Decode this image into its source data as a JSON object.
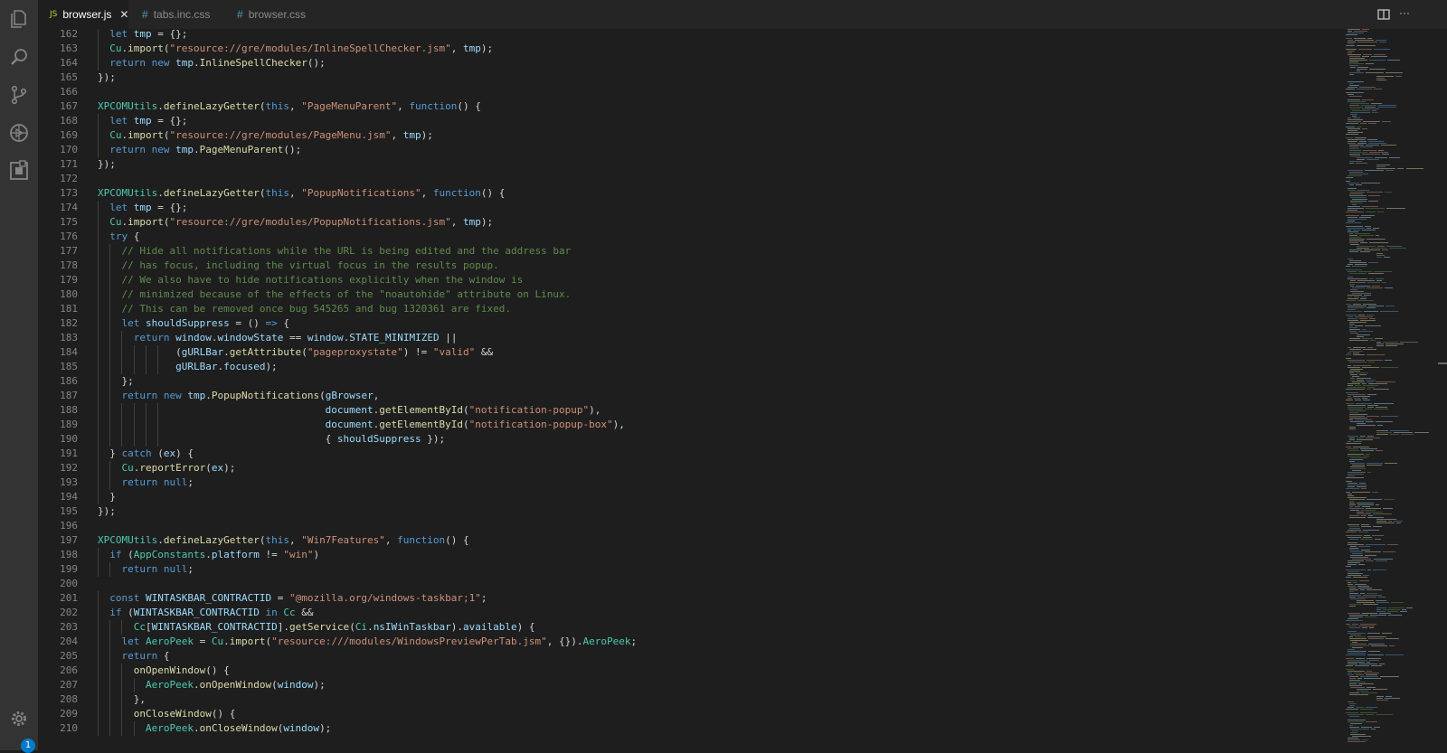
{
  "tabs": [
    {
      "label": "browser.js",
      "icon": "JS",
      "active": true
    },
    {
      "label": "tabs.inc.css",
      "icon": "#",
      "active": false
    },
    {
      "label": "browser.css",
      "icon": "#",
      "active": false
    }
  ],
  "close_glyph": "✕",
  "more_glyph": "···",
  "settings_badge": "1",
  "activity_bar": [
    "explorer-icon",
    "search-icon",
    "source-control-icon",
    "debug-icon",
    "extensions-icon",
    "settings-gear-icon"
  ],
  "colors": {
    "keyword": "#569cd6",
    "string": "#ce9178",
    "comment": "#608b4e",
    "function": "#dcdcaa",
    "variable": "#9cdcfe",
    "accent": "#007acc"
  },
  "code_lines": [
    {
      "n": "162",
      "text": "  let tmp = {};"
    },
    {
      "n": "163",
      "text": "  Cu.import(\"resource://gre/modules/InlineSpellChecker.jsm\", tmp);"
    },
    {
      "n": "164",
      "text": "  return new tmp.InlineSpellChecker();"
    },
    {
      "n": "165",
      "text": "});"
    },
    {
      "n": "166",
      "text": ""
    },
    {
      "n": "167",
      "text": "XPCOMUtils.defineLazyGetter(this, \"PageMenuParent\", function() {"
    },
    {
      "n": "168",
      "text": "  let tmp = {};"
    },
    {
      "n": "169",
      "text": "  Cu.import(\"resource://gre/modules/PageMenu.jsm\", tmp);"
    },
    {
      "n": "170",
      "text": "  return new tmp.PageMenuParent();"
    },
    {
      "n": "171",
      "text": "});"
    },
    {
      "n": "172",
      "text": ""
    },
    {
      "n": "173",
      "text": "XPCOMUtils.defineLazyGetter(this, \"PopupNotifications\", function() {"
    },
    {
      "n": "174",
      "text": "  let tmp = {};"
    },
    {
      "n": "175",
      "text": "  Cu.import(\"resource://gre/modules/PopupNotifications.jsm\", tmp);"
    },
    {
      "n": "176",
      "text": "  try {"
    },
    {
      "n": "177",
      "text": "    // Hide all notifications while the URL is being edited and the address bar"
    },
    {
      "n": "178",
      "text": "    // has focus, including the virtual focus in the results popup."
    },
    {
      "n": "179",
      "text": "    // We also have to hide notifications explicitly when the window is"
    },
    {
      "n": "180",
      "text": "    // minimized because of the effects of the \"noautohide\" attribute on Linux."
    },
    {
      "n": "181",
      "text": "    // This can be removed once bug 545265 and bug 1320361 are fixed."
    },
    {
      "n": "182",
      "text": "    let shouldSuppress = () => {"
    },
    {
      "n": "183",
      "text": "      return window.windowState == window.STATE_MINIMIZED ||"
    },
    {
      "n": "184",
      "text": "             (gURLBar.getAttribute(\"pageproxystate\") != \"valid\" &&"
    },
    {
      "n": "185",
      "text": "             gURLBar.focused);"
    },
    {
      "n": "186",
      "text": "    };"
    },
    {
      "n": "187",
      "text": "    return new tmp.PopupNotifications(gBrowser,"
    },
    {
      "n": "188",
      "text": "                                      document.getElementById(\"notification-popup\"),"
    },
    {
      "n": "189",
      "text": "                                      document.getElementById(\"notification-popup-box\"),"
    },
    {
      "n": "190",
      "text": "                                      { shouldSuppress });"
    },
    {
      "n": "191",
      "text": "  } catch (ex) {"
    },
    {
      "n": "192",
      "text": "    Cu.reportError(ex);"
    },
    {
      "n": "193",
      "text": "    return null;"
    },
    {
      "n": "194",
      "text": "  }"
    },
    {
      "n": "195",
      "text": "});"
    },
    {
      "n": "196",
      "text": ""
    },
    {
      "n": "197",
      "text": "XPCOMUtils.defineLazyGetter(this, \"Win7Features\", function() {"
    },
    {
      "n": "198",
      "text": "  if (AppConstants.platform != \"win\")"
    },
    {
      "n": "199",
      "text": "    return null;"
    },
    {
      "n": "200",
      "text": ""
    },
    {
      "n": "201",
      "text": "  const WINTASKBAR_CONTRACTID = \"@mozilla.org/windows-taskbar;1\";"
    },
    {
      "n": "202",
      "text": "  if (WINTASKBAR_CONTRACTID in Cc &&"
    },
    {
      "n": "203",
      "text": "      Cc[WINTASKBAR_CONTRACTID].getService(Ci.nsIWinTaskbar).available) {"
    },
    {
      "n": "204",
      "text": "    let AeroPeek = Cu.import(\"resource:///modules/WindowsPreviewPerTab.jsm\", {}).AeroPeek;"
    },
    {
      "n": "205",
      "text": "    return {"
    },
    {
      "n": "206",
      "text": "      onOpenWindow() {"
    },
    {
      "n": "207",
      "text": "        AeroPeek.onOpenWindow(window);"
    },
    {
      "n": "208",
      "text": "      },"
    },
    {
      "n": "209",
      "text": "      onCloseWindow() {"
    },
    {
      "n": "210",
      "text": "        AeroPeek.onCloseWindow(window);"
    }
  ]
}
